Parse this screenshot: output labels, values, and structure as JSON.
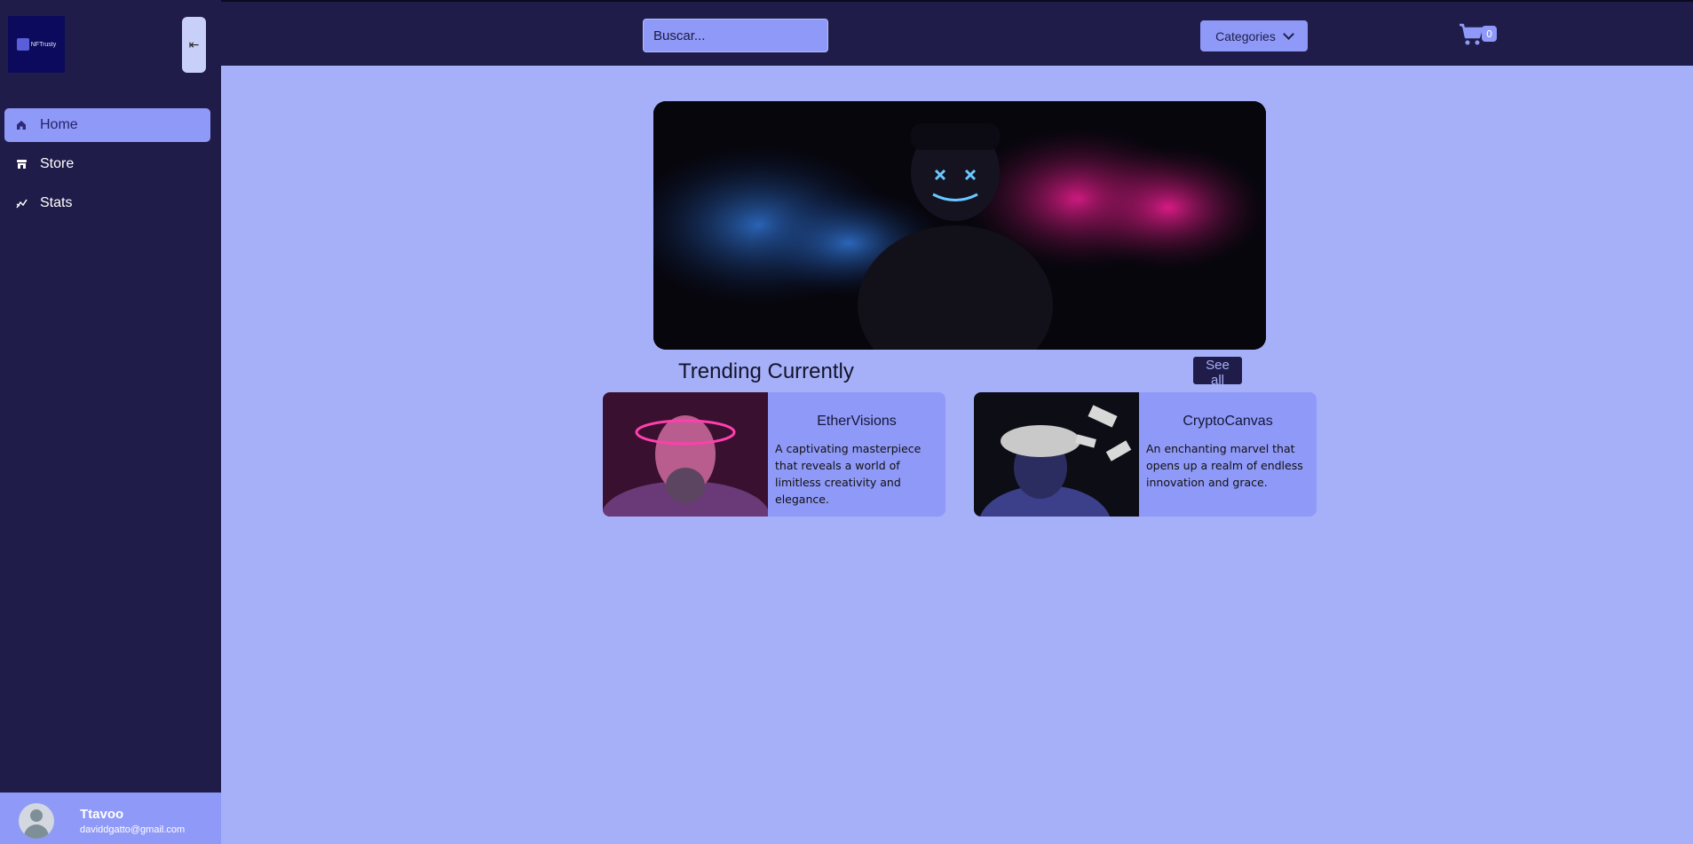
{
  "logo": {
    "text": "NFTrusty"
  },
  "sidebar": {
    "collapse_icon": "collapse-left-icon",
    "items": [
      {
        "label": "Home",
        "icon": "home-icon",
        "active": true
      },
      {
        "label": "Store",
        "icon": "store-icon",
        "active": false
      },
      {
        "label": "Stats",
        "icon": "stats-icon",
        "active": false
      }
    ]
  },
  "user": {
    "name": "Ttavoo",
    "email": "daviddgatto@gmail.com"
  },
  "header": {
    "search": {
      "placeholder": "Buscar...",
      "value": ""
    },
    "categories_label": "Categories",
    "cart_count": "0"
  },
  "trending": {
    "title": "Trending Currently",
    "see_all": "See all",
    "cards": [
      {
        "title": "EtherVisions",
        "description": "A captivating masterpiece that reveals a world of limitless creativity and elegance."
      },
      {
        "title": "CryptoCanvas",
        "description": "An enchanting marvel that opens up a realm of endless innovation and grace."
      }
    ]
  },
  "colors": {
    "sidebar_bg": "#201c4a",
    "page_bg": "#a6b0f8",
    "accent": "#8f99f7"
  }
}
